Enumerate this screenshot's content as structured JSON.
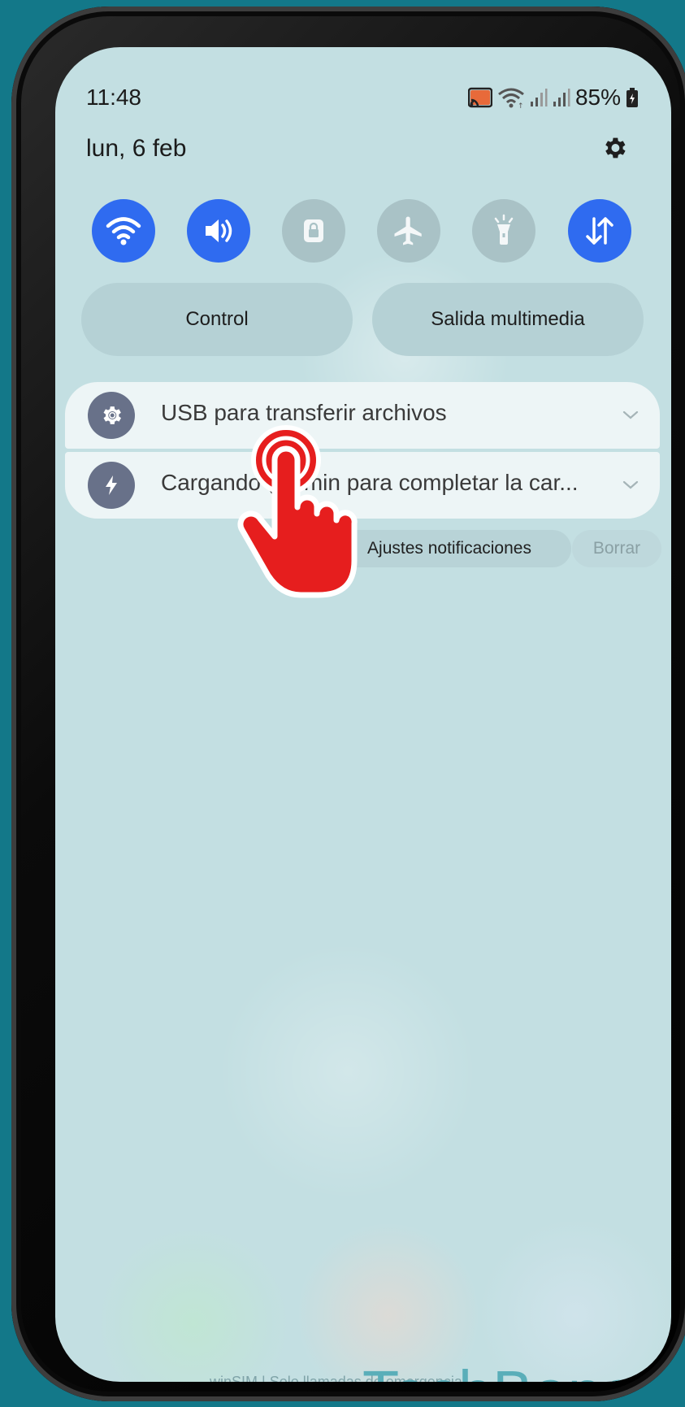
{
  "status_bar": {
    "time": "11:48",
    "battery": "85%",
    "icons": [
      "cast-icon",
      "wifi-icon",
      "signal-icon",
      "signal-icon",
      "battery-icon"
    ]
  },
  "header": {
    "date": "lun, 6 feb",
    "settings_icon": "gear-icon"
  },
  "quick_settings": [
    {
      "name": "wifi",
      "icon": "wifi-icon",
      "active": true
    },
    {
      "name": "sound",
      "icon": "speaker-icon",
      "active": true
    },
    {
      "name": "rotation-lock",
      "icon": "lock-icon",
      "active": false
    },
    {
      "name": "airplane-mode",
      "icon": "airplane-icon",
      "active": false
    },
    {
      "name": "flashlight",
      "icon": "flashlight-icon",
      "active": false
    },
    {
      "name": "mobile-data",
      "icon": "data-arrows-icon",
      "active": true
    }
  ],
  "pills": {
    "control": "Control",
    "media_output": "Salida multimedia"
  },
  "notifications": [
    {
      "icon": "usb-settings-icon",
      "text": "USB para transferir archivos"
    },
    {
      "icon": "lightning-icon",
      "text": "Cargando (… min para completar la car..."
    }
  ],
  "actions": {
    "notification_settings": "Ajustes notificaciones",
    "clear": "Borrar"
  },
  "footer": {
    "carrier": "winSIM | Solo llamadas de emergencia",
    "watermark": "TechBone"
  },
  "colors": {
    "accent": "#2f6bf0",
    "background": "#c3dfe2",
    "frame": "#137889",
    "tap_indicator": "#e61e1e"
  }
}
